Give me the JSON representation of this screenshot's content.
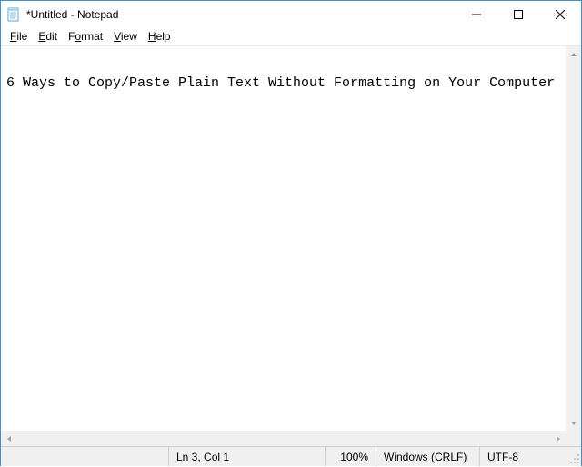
{
  "window": {
    "title": "*Untitled - Notepad"
  },
  "menu": {
    "file": "File",
    "edit": "Edit",
    "format": "Format",
    "view": "View",
    "help": "Help"
  },
  "editor": {
    "content": "6 Ways to Copy/Paste Plain Text Without Formatting on Your Computer"
  },
  "status": {
    "position": "Ln 3, Col 1",
    "zoom": "100%",
    "eol": "Windows (CRLF)",
    "encoding": "UTF-8"
  }
}
